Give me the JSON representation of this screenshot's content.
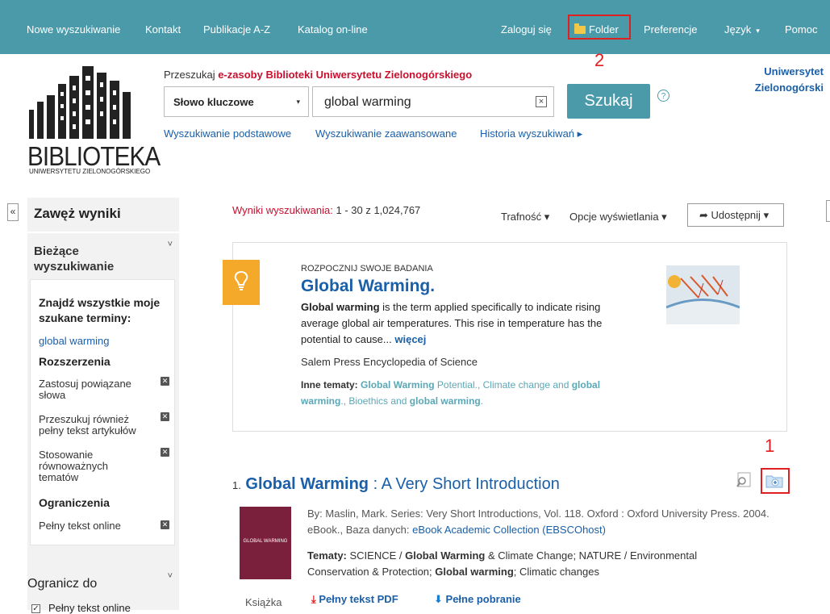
{
  "nav": {
    "left": [
      "Nowe wyszukiwanie",
      "Kontakt",
      "Publikacje A-Z",
      "Katalog on-line"
    ],
    "login": "Zaloguj się",
    "folder": "Folder",
    "prefs": "Preferencje",
    "lang": "Język",
    "help": "Pomoc"
  },
  "annotations": {
    "num1": "1",
    "num2": "2"
  },
  "logo": {
    "text": "BIBLIOTEKA",
    "sub": "UNIWERSYTETU ZIELONOGÓRSKIEGO"
  },
  "search": {
    "label_prefix": "Przeszukaj ",
    "label_strong": "e-zasoby Biblioteki Uniwersytetu Zielonogórskiego",
    "field": "Słowo kluczowe",
    "query": "global warming",
    "button": "Szukaj",
    "help": "?",
    "links": [
      "Wyszukiwanie podstawowe",
      "Wyszukiwanie zaawansowane",
      "Historia wyszukiwań ▸"
    ]
  },
  "university": {
    "line1": "Uniwersytet",
    "line2": "Zielonogórski"
  },
  "sidebar": {
    "collapse": "«",
    "title": "Zawęż wyniki",
    "current_search": "Bieżące wyszukiwanie",
    "find_all_label": "Znajdź wszystkie moje szukane terminy:",
    "find_all_value": "global warming",
    "extensions_title": "Rozszerzenia",
    "extensions": [
      "Zastosuj powiązane słowa",
      "Przeszukuj również pełny tekst artykułów",
      "Stosowanie równoważnych tematów"
    ],
    "limits_title": "Ograniczenia",
    "limits": [
      "Pełny tekst online"
    ],
    "limit_to": "Ogranicz do",
    "limit_option": "Pełny tekst online"
  },
  "results": {
    "label": "Wyniki wyszukiwania:",
    "range": "1 - 30 z 1,024,767",
    "sort": "Trafność",
    "display": "Opcje wyświetlania",
    "share": "Udostępnij"
  },
  "card": {
    "kicker": "ROZPOCZNIJ SWOJE BADANIA",
    "title": "Global Warming.",
    "desc_bold": "Global warming",
    "desc_rest": " is the term applied specifically to indicate rising average global air temperatures. This rise in temperature has the potential to cause... ",
    "more": "więcej",
    "source": "Salem Press Encyclopedia of Science",
    "topics_label": "Inne tematy:",
    "t1_bold": "Global Warming",
    "t1_rest": " Potential.",
    "t2_rest": "Climate change and ",
    "t2_bold": "global warming",
    "t2_end": ".",
    "t3_rest": "Bioethics and ",
    "t3_bold": "global warming",
    "t3_end": "."
  },
  "result1": {
    "num": "1.",
    "title_bold": "Global Warming",
    "title_rest": " : A Very Short Introduction",
    "cover_text": "GLOBAL WARMING",
    "meta": "By: Maslin, Mark. Series: Very Short Introductions, Vol. 118. Oxford : Oxford University Press. 2004. eBook., Baza danych: ",
    "db": "eBook Academic Collection (EBSCOhost)",
    "topics_label": "Tematy:",
    "topics_a": " SCIENCE / ",
    "topics_b": "Global Warming",
    "topics_c": " & Climate Change; NATURE / Environmental Conservation & Protection; ",
    "topics_d": "Global warming",
    "topics_e": "; Climatic changes",
    "format": "Książka",
    "pdf": "Pełny tekst PDF",
    "download": "Pełne pobranie"
  }
}
